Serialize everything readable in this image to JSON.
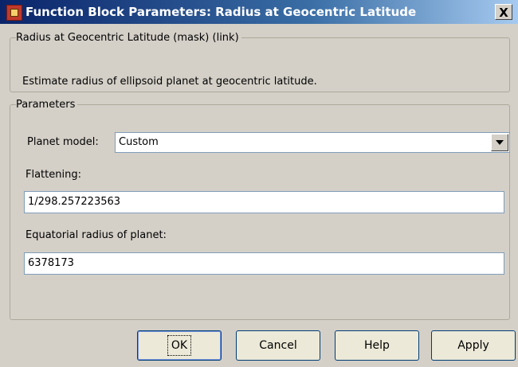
{
  "window": {
    "title": "Function Block Parameters: Radius at Geocentric Latitude",
    "close_label": "X"
  },
  "description_group": {
    "legend": "Radius at Geocentric Latitude (mask) (link)",
    "text": "Estimate radius of ellipsoid planet at geocentric latitude."
  },
  "parameters_group": {
    "legend": "Parameters",
    "planet_model": {
      "label": "Planet model:",
      "value": "Custom"
    },
    "flattening": {
      "label": "Flattening:",
      "value": "1/298.257223563"
    },
    "equatorial_radius": {
      "label": "Equatorial radius of planet:",
      "value": "6378173"
    }
  },
  "buttons": {
    "ok": "OK",
    "cancel": "Cancel",
    "help": "Help",
    "apply": "Apply"
  },
  "colors": {
    "titlebar_start": "#0a246a",
    "titlebar_end": "#a6caf0",
    "dialog_bg": "#d4d0c8"
  },
  "icons": {
    "app_icon": "simulink-block-icon",
    "close_icon": "close-icon",
    "dropdown_icon": "chevron-down-icon"
  }
}
